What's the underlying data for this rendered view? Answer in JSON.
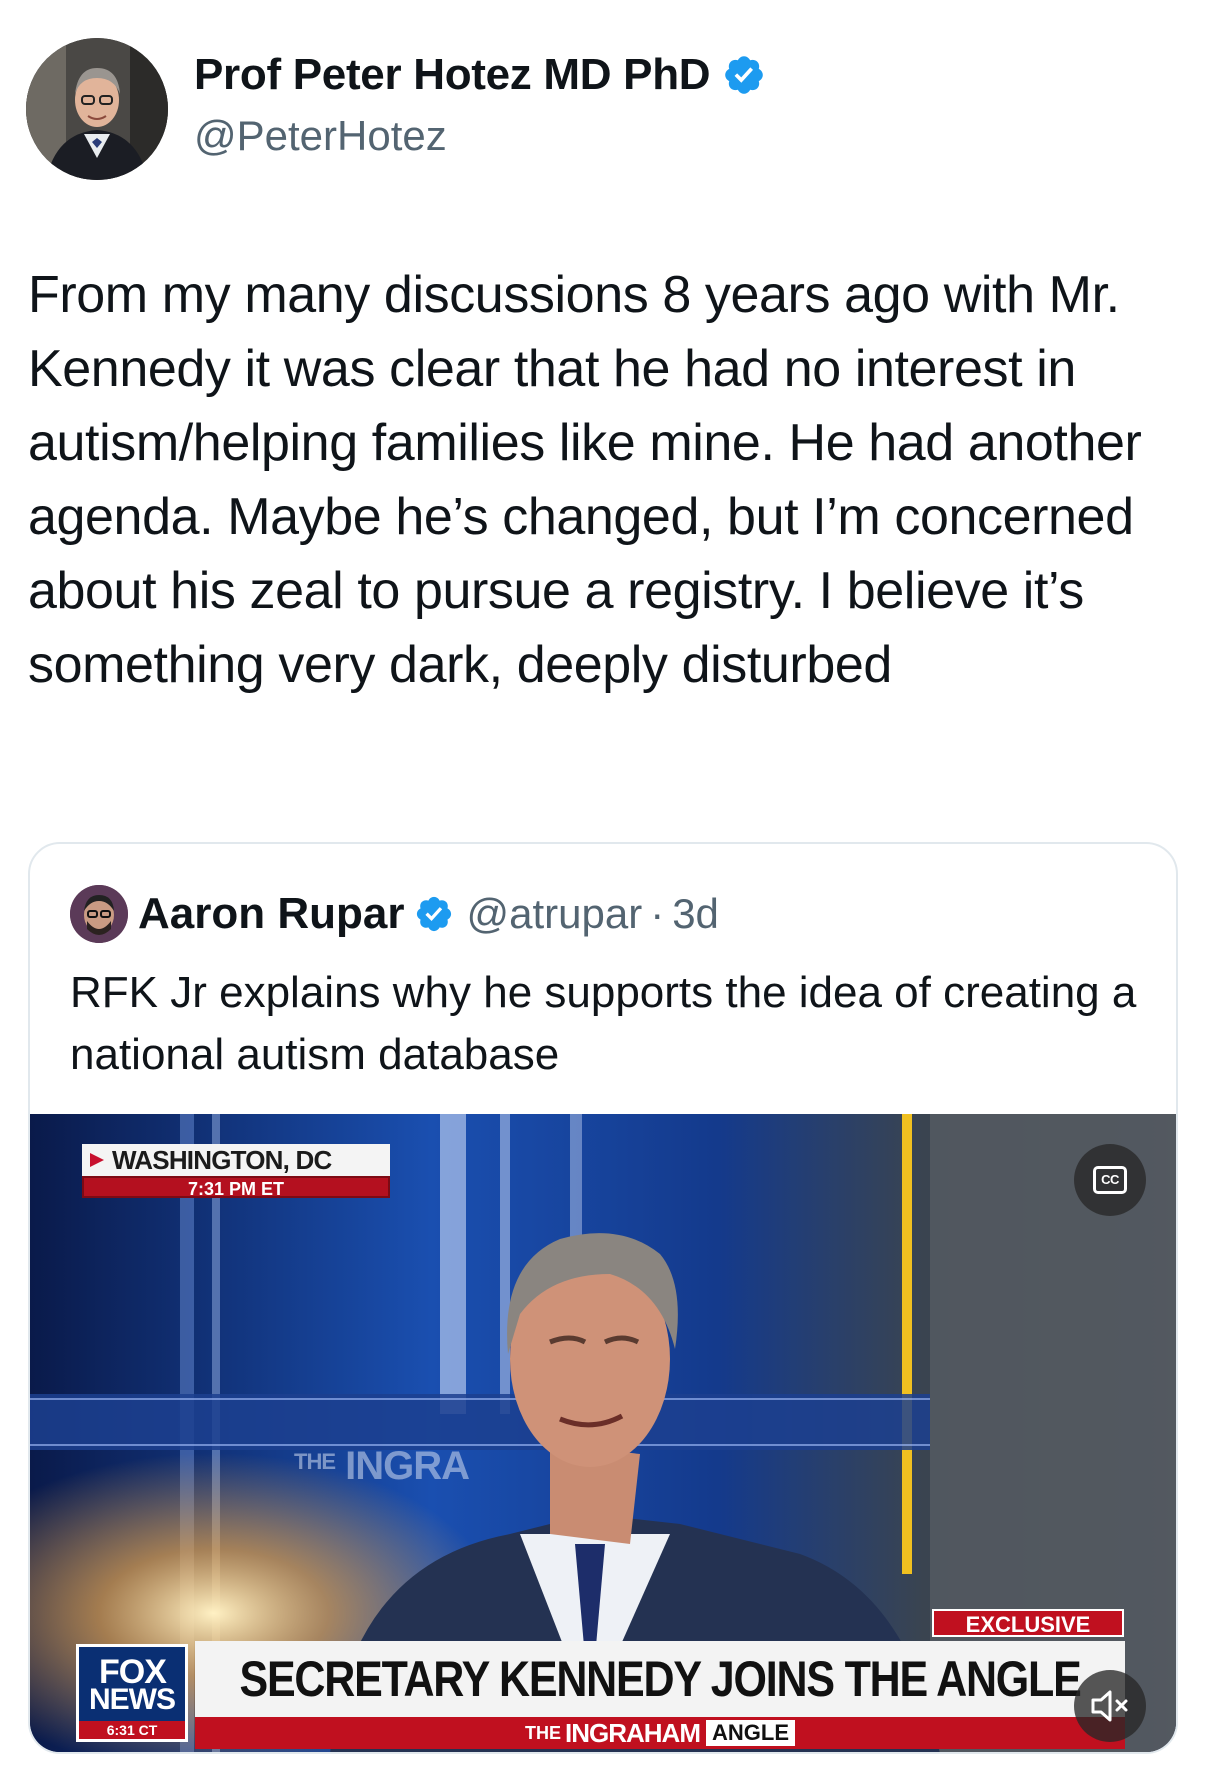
{
  "author": {
    "name": "Prof Peter Hotez MD PhD",
    "handle": "@PeterHotez",
    "verified_badge_icon": "verified-badge-icon",
    "badge_color": "#1d9bf0"
  },
  "tweet": {
    "text": "From my many discussions 8 years ago with Mr. Kennedy it was clear that he had no interest in autism/helping families like mine. He had another agenda. Maybe he’s changed, but I’m concerned about his zeal to pursue a registry. I believe it’s something very dark, deeply disturbed"
  },
  "quoted_tweet": {
    "name": "Aaron Rupar",
    "handle": "@atrupar",
    "separator": "·",
    "time": "3d",
    "text": "RFK Jr explains why he supports the idea of creating a national autism database",
    "media": {
      "location": "WASHINGTON, DC",
      "local_time": "7:31 PM ET",
      "studio_backdrop_the": "THE",
      "studio_backdrop_text": "INGRA",
      "exclusive_label": "EXCLUSIVE",
      "headline": "SECRETARY KENNEDY JOINS THE ANGLE",
      "show_the": "THE",
      "show_name": "INGRAHAM",
      "show_angle": "ANGLE",
      "network_line1": "FOX",
      "network_line2": "NEWS",
      "network_time": "6:31 CT",
      "cc_label": "CC",
      "accent_red": "#c0101f",
      "accent_navy": "#0a2f73"
    }
  }
}
